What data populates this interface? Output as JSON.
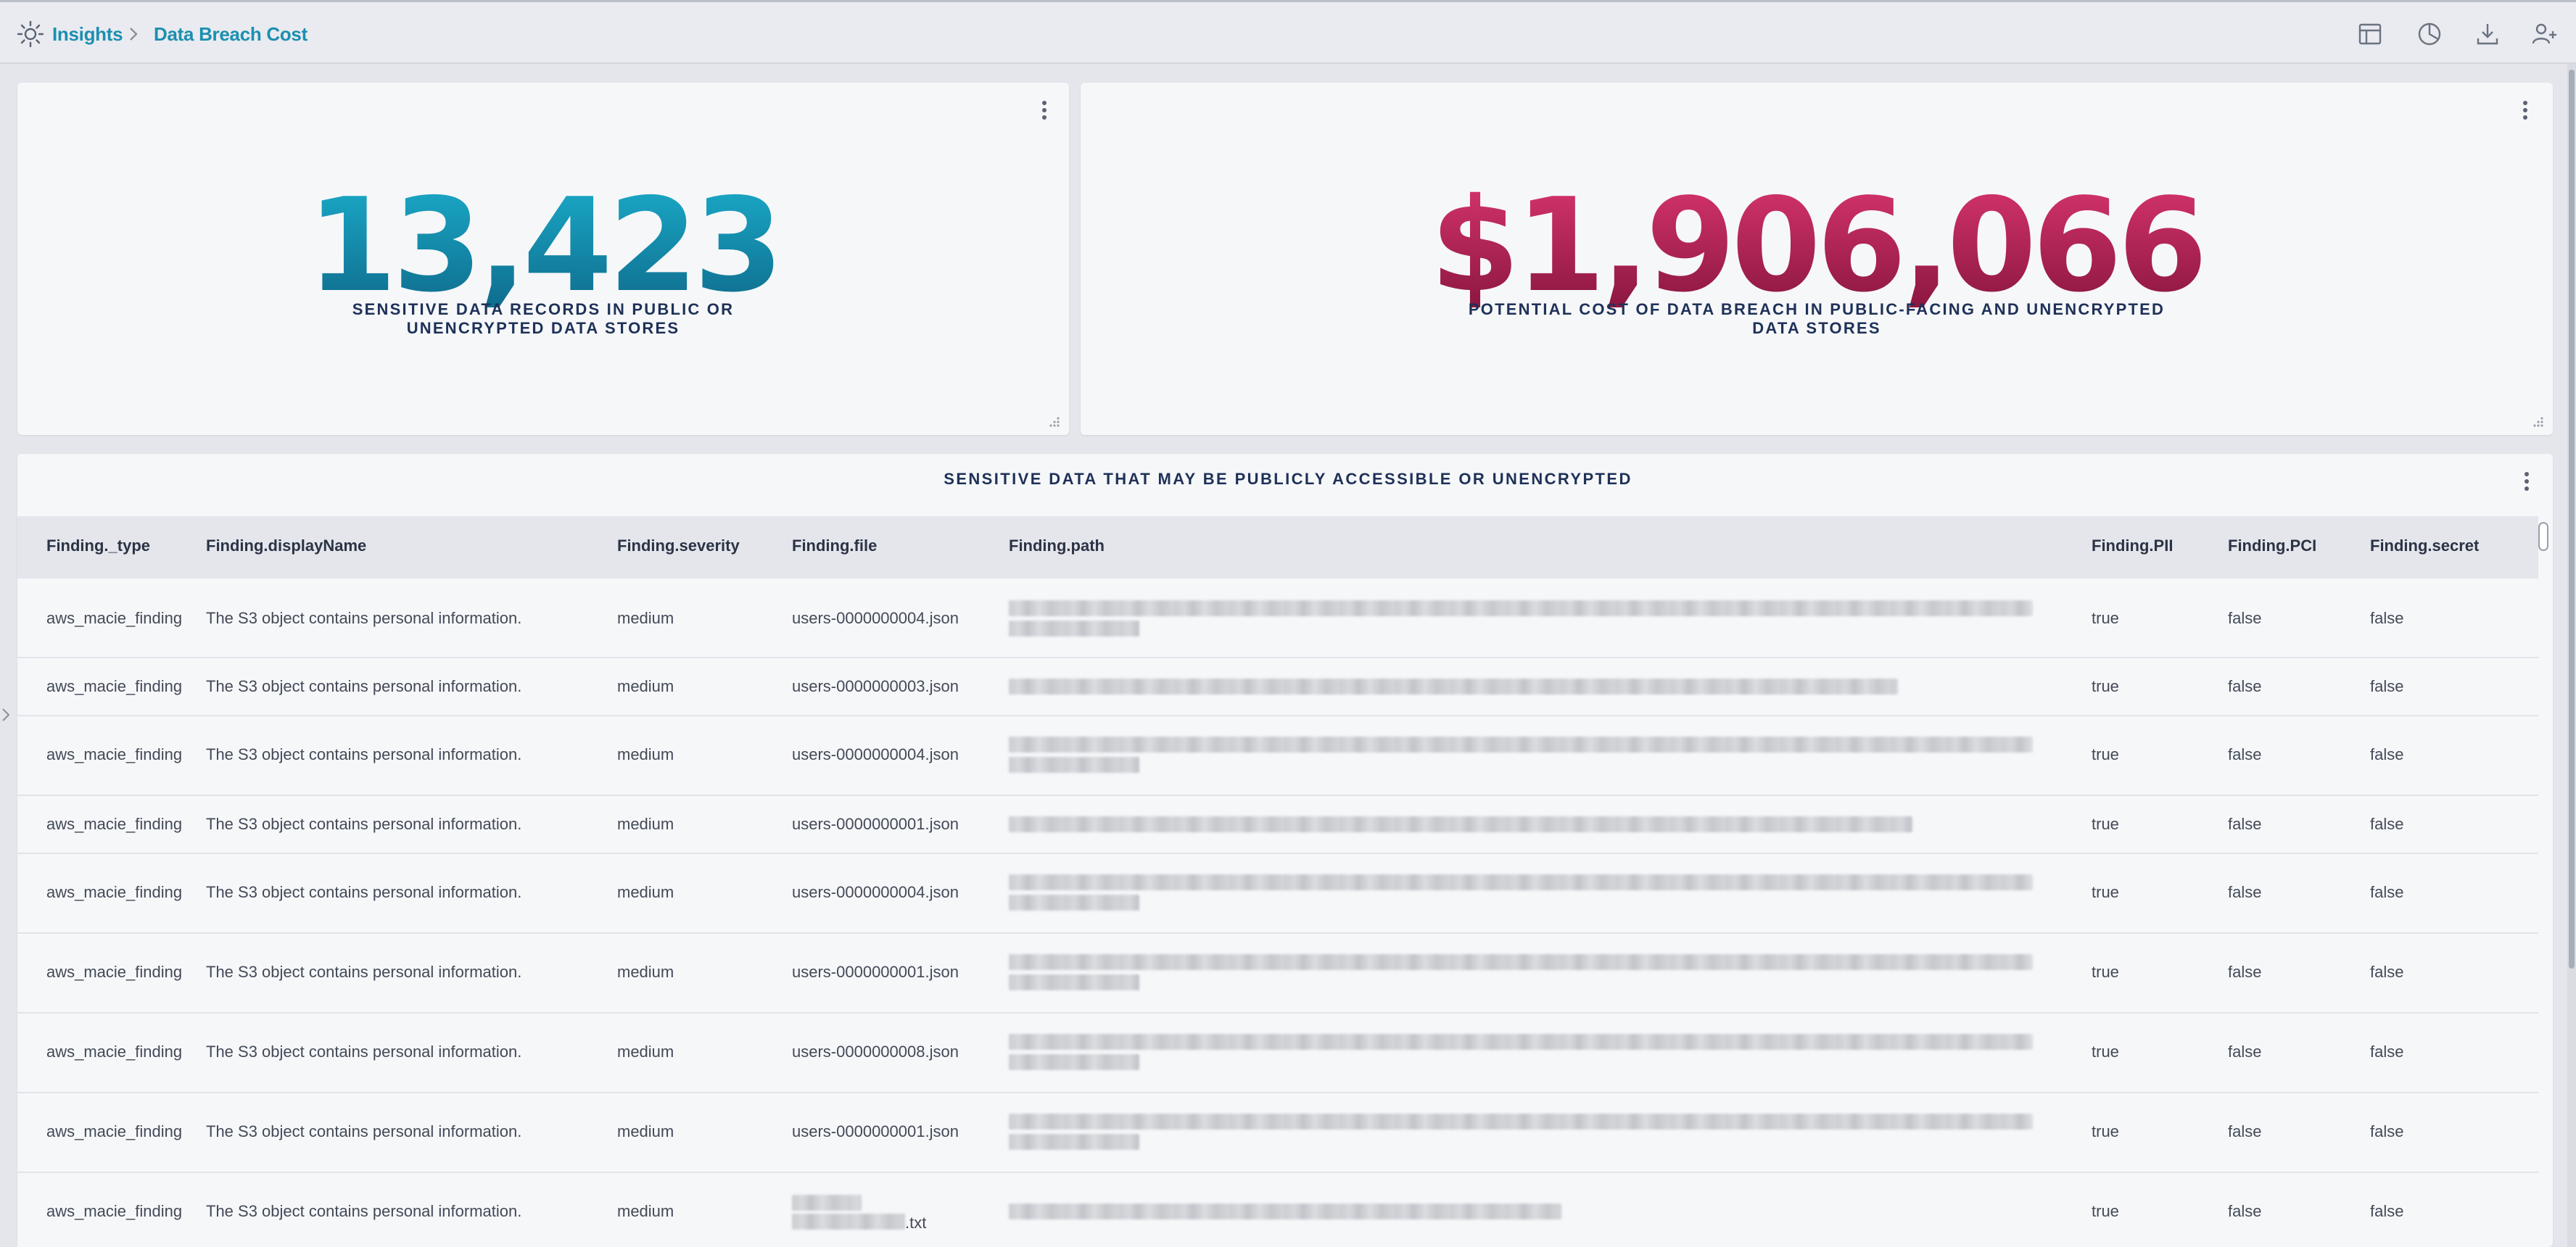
{
  "breadcrumb": {
    "root": "Insights",
    "current": "Data Breach Cost"
  },
  "toolbar": {
    "icons": [
      "layout-icon",
      "pie-chart-icon",
      "download-icon",
      "add-user-icon"
    ]
  },
  "kpi_left": {
    "value": "13,423",
    "caption_line1": "SENSITIVE DATA RECORDS IN PUBLIC OR",
    "caption_line2": "UNENCRYPTED DATA STORES",
    "color": "#138aab"
  },
  "kpi_right": {
    "value": "$1,906,066",
    "caption_line1": "POTENTIAL COST OF DATA BREACH IN PUBLIC-FACING AND UNENCRYPTED",
    "caption_line2": "DATA STORES",
    "color": "#b2214f"
  },
  "table": {
    "title": "SENSITIVE DATA THAT MAY BE PUBLICLY ACCESSIBLE OR UNENCRYPTED",
    "columns": [
      "Finding._type",
      "Finding.displayName",
      "Finding.severity",
      "Finding.file",
      "Finding.path",
      "Finding.PII",
      "Finding.PCI",
      "Finding.secret"
    ],
    "rows": [
      {
        "type": "aws_macie_finding",
        "displayName": "The S3 object contains personal information.",
        "severity": "medium",
        "file": "users-0000000004.json",
        "pii": "true",
        "pci": "false",
        "secret": "false"
      },
      {
        "type": "aws_macie_finding",
        "displayName": "The S3 object contains personal information.",
        "severity": "medium",
        "file": "users-0000000003.json",
        "pii": "true",
        "pci": "false",
        "secret": "false"
      },
      {
        "type": "aws_macie_finding",
        "displayName": "The S3 object contains personal information.",
        "severity": "medium",
        "file": "users-0000000004.json",
        "pii": "true",
        "pci": "false",
        "secret": "false"
      },
      {
        "type": "aws_macie_finding",
        "displayName": "The S3 object contains personal information.",
        "severity": "medium",
        "file": "users-0000000001.json",
        "pii": "true",
        "pci": "false",
        "secret": "false"
      },
      {
        "type": "aws_macie_finding",
        "displayName": "The S3 object contains personal information.",
        "severity": "medium",
        "file": "users-0000000004.json",
        "pii": "true",
        "pci": "false",
        "secret": "false"
      },
      {
        "type": "aws_macie_finding",
        "displayName": "The S3 object contains personal information.",
        "severity": "medium",
        "file": "users-0000000001.json",
        "pii": "true",
        "pci": "false",
        "secret": "false"
      },
      {
        "type": "aws_macie_finding",
        "displayName": "The S3 object contains personal information.",
        "severity": "medium",
        "file": "users-0000000008.json",
        "pii": "true",
        "pci": "false",
        "secret": "false"
      },
      {
        "type": "aws_macie_finding",
        "displayName": "The S3 object contains personal information.",
        "severity": "medium",
        "file": "users-0000000001.json",
        "pii": "true",
        "pci": "false",
        "secret": "false"
      },
      {
        "type": "aws_macie_finding",
        "displayName": "The S3 object contains personal information.",
        "severity": "medium",
        "file": ".txt",
        "pii": "true",
        "pci": "false",
        "secret": "false"
      }
    ]
  }
}
